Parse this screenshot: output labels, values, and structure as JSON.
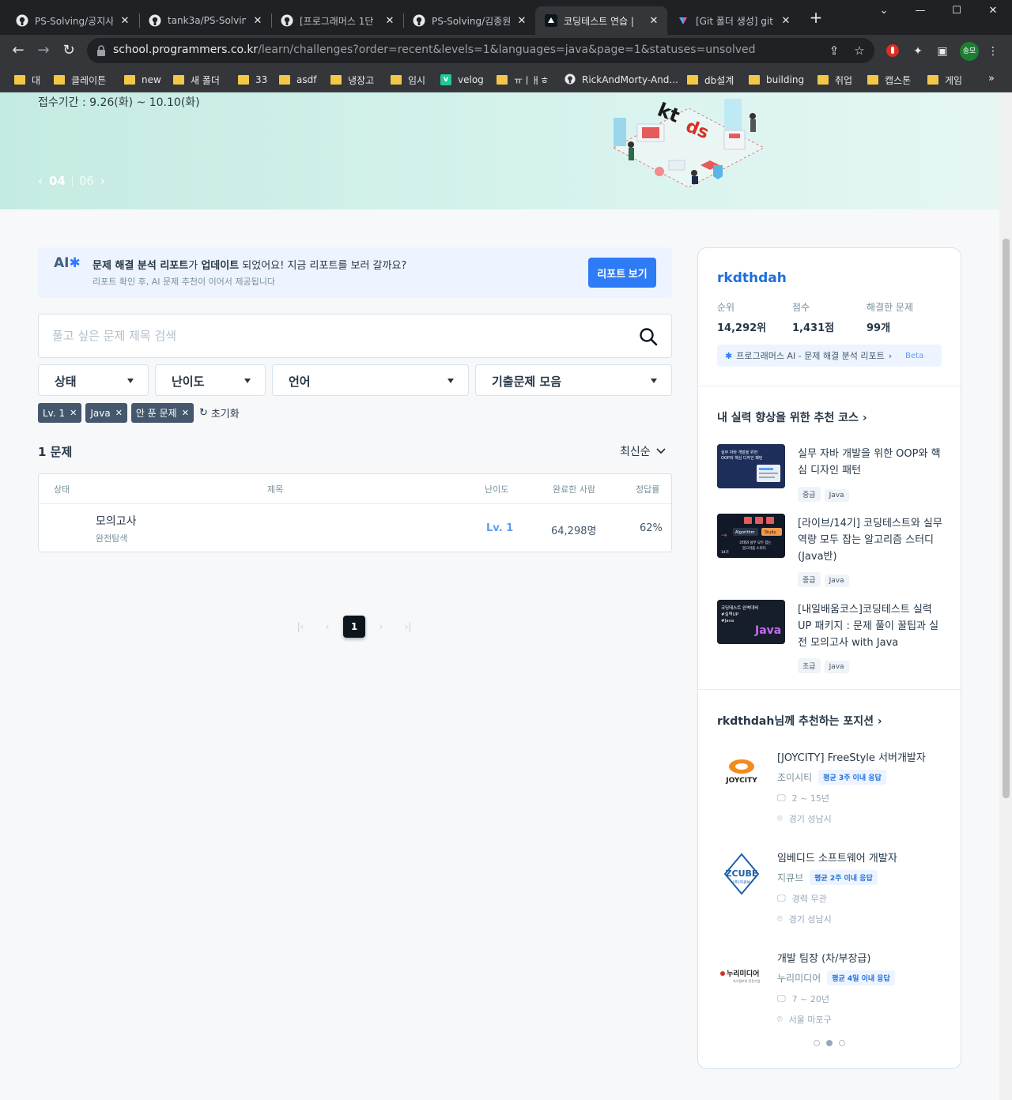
{
  "browser": {
    "tabs": [
      {
        "title": "PS-Solving/공지사",
        "favicon": "github-icon",
        "active": false
      },
      {
        "title": "tank3a/PS-Solving",
        "favicon": "github-icon",
        "active": false
      },
      {
        "title": "[프로그래머스 1단",
        "favicon": "github-icon",
        "active": false
      },
      {
        "title": "PS-Solving/김종원",
        "favicon": "github-icon",
        "active": false
      },
      {
        "title": "코딩테스트 연습 |",
        "favicon": "programmers-icon",
        "active": true
      },
      {
        "title": "[Git 폴더 생성] git",
        "favicon": "velog-icon",
        "active": false
      }
    ],
    "url_host": "school.programmers.co.kr",
    "url_path": "/learn/challenges?order=recent&levels=1&languages=java&page=1&statuses=unsolved",
    "profile_initials": "송모",
    "bookmarks": [
      {
        "label": "대",
        "type": "folder"
      },
      {
        "label": "클레이튼",
        "type": "folder"
      },
      {
        "label": "new",
        "type": "folder"
      },
      {
        "label": "새 폴더",
        "type": "folder"
      },
      {
        "label": "33",
        "type": "folder"
      },
      {
        "label": "asdf",
        "type": "folder"
      },
      {
        "label": "냉장고",
        "type": "folder"
      },
      {
        "label": "임시",
        "type": "folder"
      },
      {
        "label": "velog",
        "type": "velog"
      },
      {
        "label": "ㅠㅣㅐㅎ",
        "type": "folder"
      },
      {
        "label": "RickAndMorty-And...",
        "type": "github"
      },
      {
        "label": "db설계",
        "type": "folder"
      },
      {
        "label": "building",
        "type": "folder"
      },
      {
        "label": "취업",
        "type": "folder"
      },
      {
        "label": "캡스톤",
        "type": "folder"
      },
      {
        "label": "게임",
        "type": "folder"
      }
    ]
  },
  "banner": {
    "period": "접수기간 : 9.26(화) ~ 10.10(화)",
    "current": "04",
    "total": "06"
  },
  "ai_notice": {
    "logo": "AI",
    "msg_b1": "문제 해결 분석 리포트",
    "msg_t1": "가 ",
    "msg_b2": "업데이트",
    "msg_t2": " 되었어요! 지금 리포트를 보러 갈까요?",
    "sub": "리포트 확인 후, AI 문제 추천이 이어서 제공됩니다",
    "button": "리포트 보기"
  },
  "search": {
    "placeholder": "풀고 싶은 문제 제목 검색",
    "value": ""
  },
  "filters": {
    "status": "상태",
    "difficulty": "난이도",
    "language": "언어",
    "collection": "기출문제 모음"
  },
  "chips": [
    "Lv. 1",
    "Java",
    "안 푼 문제"
  ],
  "reset_label": "초기화",
  "result_count": "1 문제",
  "sort_label": "최신순",
  "table": {
    "headers": {
      "status": "상태",
      "title": "제목",
      "level": "난이도",
      "completed": "완료한 사람",
      "rate": "정답률"
    },
    "rows": [
      {
        "title": "모의고사",
        "category": "완전탐색",
        "level": "Lv. 1",
        "completed": "64,298명",
        "rate": "62%"
      }
    ]
  },
  "pagination": {
    "current": "1"
  },
  "profile": {
    "username": "rkdthdah",
    "rank_label": "순위",
    "rank": "14,292위",
    "score_label": "점수",
    "score": "1,431점",
    "solved_label": "해결한 문제",
    "solved": "99개",
    "ai_report": "프로그래머스 AI - 문제 해결 분석 리포트",
    "beta": "Beta"
  },
  "courses": {
    "title": "내 실력 향상을 위한 추천 코스",
    "items": [
      {
        "title": "실무 자바 개발을 위한 OOP와 핵심 디자인 패턴",
        "level": "중급",
        "lang": "Java",
        "thumb_lines": [
          "실무 자바 개발을 위한",
          "OOP와 핵심 디자인 패턴"
        ]
      },
      {
        "title": "[라이브/14기] 코딩테스트와 실무 역량 모두 잡는 알고리즘 스터디(Java반)",
        "level": "중급",
        "lang": "Java",
        "thumb_lines": [
          "Algorithm",
          "Study",
          "코테와 실무 모두 잡는",
          "알고리즘 스터디",
          "14기"
        ]
      },
      {
        "title": "[내일배움코스]코딩테스트 실력 UP 패키지 : 문제 풀이 꿀팁과 실전 모의고사 with Java",
        "level": "초급",
        "lang": "Java",
        "thumb_lines": [
          "코딩테스트 완벽대비",
          "#실력UP",
          "#Java",
          "Java"
        ]
      }
    ]
  },
  "positions": {
    "title": "rkdthdah님께 추천하는 포지션",
    "items": [
      {
        "title": "[JOYCITY] FreeStyle 서버개발자",
        "company": "조이시티",
        "response": "평균 3주 이내 응답",
        "career": "2 ~ 15년",
        "location": "경기 성남시",
        "logo_text": "JOYCITY"
      },
      {
        "title": "임베디드 소프트웨어 개발자",
        "company": "지큐브",
        "response": "평균 2주 이내 응답",
        "career": "경력 무관",
        "location": "경기 성남시",
        "logo_text": "ZCUBE",
        "logo_sub": "(주)지큐브"
      },
      {
        "title": "개발 팀장 (차/부장급)",
        "company": "누리미디어",
        "response": "평균 4일 이내 응답",
        "career": "7 ~ 20년",
        "location": "서울 마포구",
        "logo_text": "누리미디어",
        "logo_sub": "지식정보의 전문기업"
      }
    ]
  },
  "colors": {
    "accent": "#2e7bf6",
    "chip": "#44576c",
    "banner": "#c4ebe3"
  }
}
